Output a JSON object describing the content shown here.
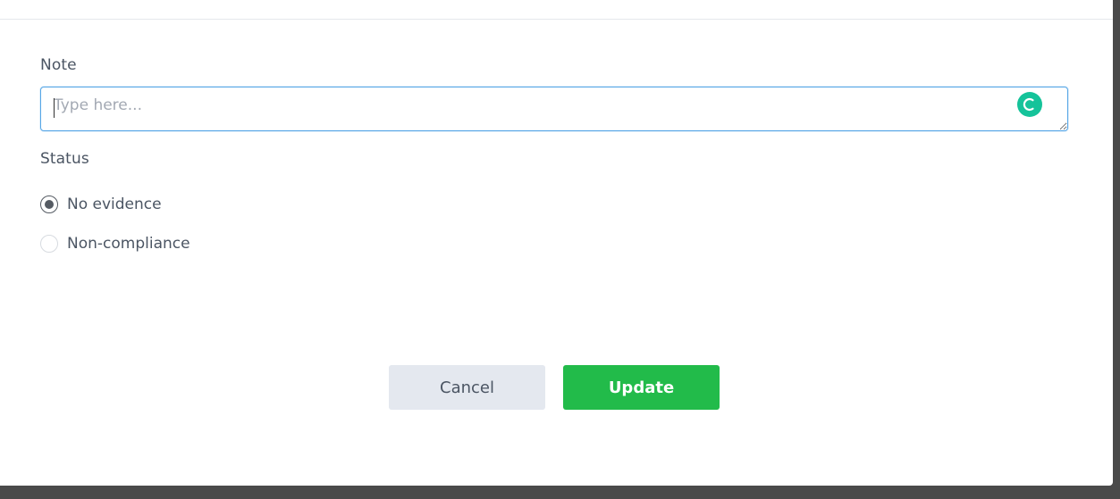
{
  "form": {
    "note": {
      "label": "Note",
      "placeholder": "Type here...",
      "value": ""
    },
    "status": {
      "label": "Status",
      "options": [
        {
          "label": "No evidence",
          "checked": true
        },
        {
          "label": "Non-compliance",
          "checked": false
        }
      ]
    }
  },
  "actions": {
    "cancel_label": "Cancel",
    "update_label": "Update"
  },
  "colors": {
    "primary": "#22bb4a",
    "input_focus_border": "#56a6e6",
    "assist_icon": "#15c39a"
  },
  "icons": {
    "assist": "grammar-assistant-icon"
  }
}
